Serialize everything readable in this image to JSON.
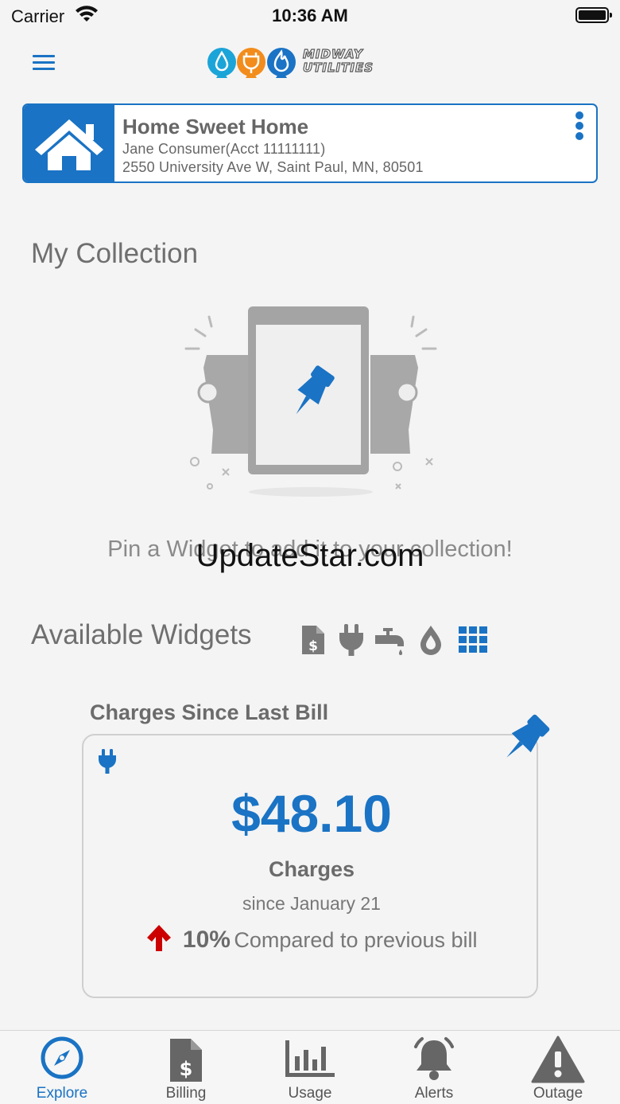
{
  "status_bar": {
    "carrier": "Carrier",
    "time": "10:36 AM"
  },
  "header": {
    "logo_line1": "MIDWAY",
    "logo_line2": "UTILITIES",
    "brand_colors": {
      "water": "#1ba4d8",
      "electric": "#f28c1c",
      "gas": "#1a73c4",
      "primary": "#1a73c4"
    }
  },
  "account": {
    "name": "Home Sweet Home",
    "holder": "Jane Consumer(Acct 11111111)",
    "address": "2550 University Ave W, Saint Paul, MN, 80501",
    "icon": "house-icon"
  },
  "collection": {
    "title": "My Collection",
    "empty_message": "Pin a Widget to add it to your collection!",
    "watermark": "UpdateStar.com"
  },
  "widgets": {
    "title": "Available Widgets",
    "filters": [
      {
        "name": "billing-filter",
        "icon": "bill-dollar-icon",
        "active": false
      },
      {
        "name": "electric-filter",
        "icon": "plug-icon",
        "active": false
      },
      {
        "name": "water-filter",
        "icon": "faucet-icon",
        "active": false
      },
      {
        "name": "gas-filter",
        "icon": "drop-icon",
        "active": false
      },
      {
        "name": "all-filter",
        "icon": "grid-icon",
        "active": true
      }
    ]
  },
  "charges_widget": {
    "title": "Charges Since Last Bill",
    "amount": "$48.10",
    "label": "Charges",
    "since": "since January 21",
    "percent": "10%",
    "compare_text": "Compared to previous bill",
    "trend": "up",
    "trend_color": "#cc0000"
  },
  "tabs": [
    {
      "label": "Explore",
      "icon": "compass-icon",
      "active": true
    },
    {
      "label": "Billing",
      "icon": "bill-dollar-icon",
      "active": false
    },
    {
      "label": "Usage",
      "icon": "bar-chart-icon",
      "active": false
    },
    {
      "label": "Alerts",
      "icon": "bell-icon",
      "active": false
    },
    {
      "label": "Outage",
      "icon": "warning-icon",
      "active": false
    }
  ]
}
